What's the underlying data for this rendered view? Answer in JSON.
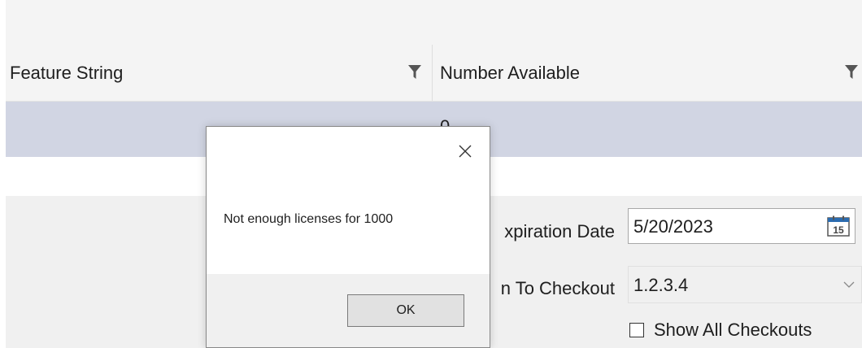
{
  "grid": {
    "columns": [
      {
        "label": "Feature String",
        "icon": "filter-icon"
      },
      {
        "label": "Number Available",
        "icon": "filter-icon"
      }
    ],
    "selected_row": {
      "number_available": "0"
    }
  },
  "form": {
    "expiration_label": "xpiration Date",
    "expiration_value": "5/20/2023",
    "calendar_icon_text": "15",
    "checkout_label": "n To Checkout",
    "checkout_value": "1.2.3.4",
    "show_all_label": "Show All Checkouts"
  },
  "dialog": {
    "message": "Not enough licenses for 1000",
    "ok_label": "OK",
    "close_icon": "close-icon"
  },
  "colors": {
    "header_bg": "#f4f4f4",
    "selected_row_bg": "#d1d5e3",
    "form_bg": "#f0f0f0",
    "dialog_footer_bg": "#f0f0f0",
    "calendar_blue": "#2b6cb0"
  }
}
